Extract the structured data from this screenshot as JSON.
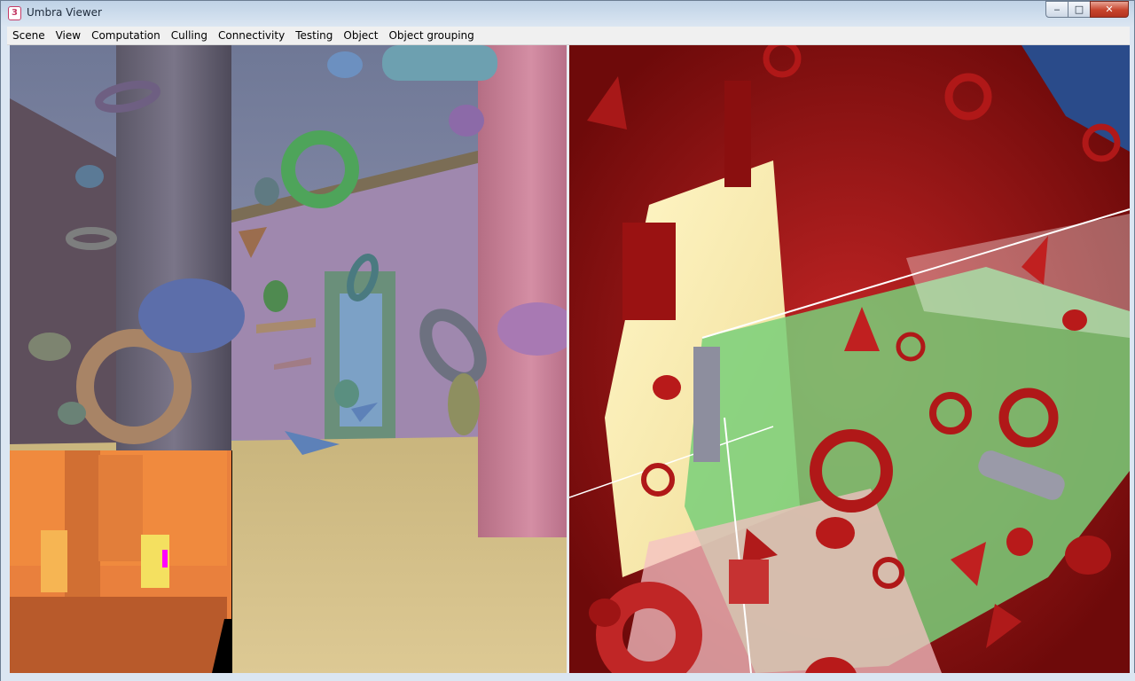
{
  "window": {
    "title": "Umbra Viewer",
    "app_icon_glyph": "3",
    "controls": {
      "minimize": "‒",
      "maximize": "□",
      "close": "✕"
    }
  },
  "menubar": {
    "items": [
      "Scene",
      "View",
      "Computation",
      "Culling",
      "Connectivity",
      "Testing",
      "Object",
      "Object grouping"
    ]
  },
  "colors": {
    "left_sky": "#7e88a8",
    "left_floor": "#cdb780",
    "wall_pink": "#c77e95",
    "pillar_gray": "#6a6578",
    "right_red": "#a01818",
    "right_green_panel": "#78d078",
    "right_yellow_panel": "#f8f0b8",
    "overlay_orange": "#e9803d",
    "overlay_magenta": "#ff00ff"
  },
  "icons": {
    "app": "umbra-app-icon",
    "minimize": "minimize-icon",
    "maximize": "maximize-icon",
    "close": "close-icon"
  }
}
